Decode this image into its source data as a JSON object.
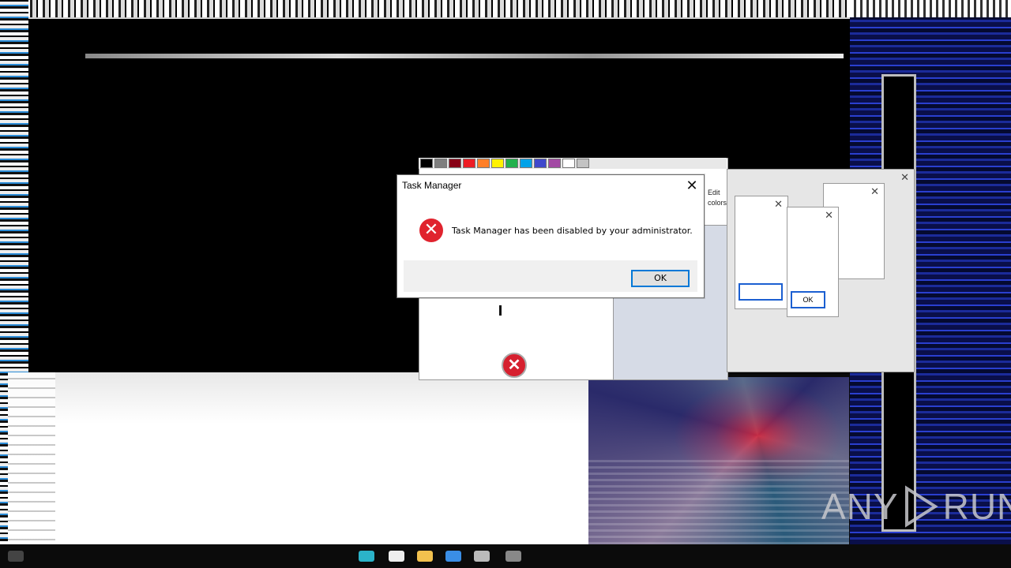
{
  "dialog": {
    "title": "Task Manager",
    "message": "Task Manager has been disabled by your administrator.",
    "ok_label": "OK",
    "close_glyph": "✕",
    "icon": "error-icon"
  },
  "background_windows": {
    "paint_edit_label": "Edit",
    "paint_colors_label": "colors",
    "ghost_button_label": "OK"
  },
  "watermark": {
    "text_left": "ANY",
    "text_right": "RUN"
  },
  "colors": {
    "error_red": "#e0232e",
    "dialog_accent": "#0078d7",
    "desktop_blue": "#1b2b9a"
  },
  "palette": [
    "#000000",
    "#7f7f7f",
    "#880015",
    "#ed1c24",
    "#ff7f27",
    "#fff200",
    "#22b14c",
    "#00a2e8",
    "#3f48cc",
    "#a349a4",
    "#ffffff",
    "#c3c3c3"
  ],
  "taskbar": {
    "icons": [
      "start-icon",
      "search-icon",
      "task-view-icon",
      "explorer-icon",
      "edge-icon",
      "store-icon",
      "network-icon"
    ]
  }
}
